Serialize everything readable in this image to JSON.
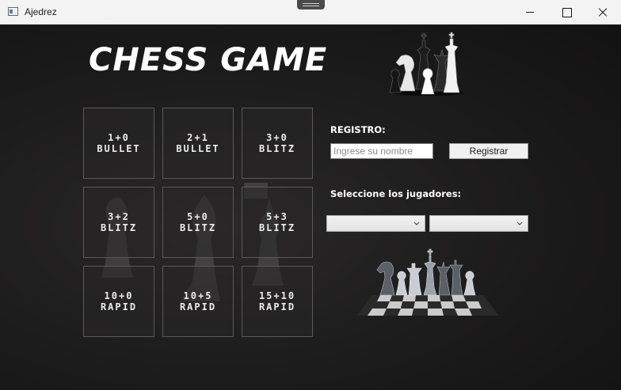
{
  "window": {
    "title": "Ajedrez",
    "icon": "app-window-icon",
    "controls": [
      "minimize-icon",
      "maximize-icon",
      "close-icon"
    ]
  },
  "main": {
    "title": "CHESS GAME",
    "tiles": [
      {
        "time": "1+0",
        "mode": "BULLET"
      },
      {
        "time": "2+1",
        "mode": "BULLET"
      },
      {
        "time": "3+0",
        "mode": "BLITZ"
      },
      {
        "time": "3+2",
        "mode": "BLITZ"
      },
      {
        "time": "5+0",
        "mode": "BLITZ"
      },
      {
        "time": "5+3",
        "mode": "BLITZ"
      },
      {
        "time": "10+0",
        "mode": "RAPID"
      },
      {
        "time": "10+5",
        "mode": "RAPID"
      },
      {
        "time": "15+10",
        "mode": "RAPID"
      }
    ]
  },
  "registro": {
    "label": "REGISTRO:",
    "placeholder": "Ingrese su nombre",
    "value": "",
    "button_label": "Registrar"
  },
  "players": {
    "label": "Seleccione los jugadores:",
    "player1_selected": "",
    "player2_selected": ""
  },
  "colors": {
    "background": "#1a1919",
    "tile_border": "#5a5858",
    "text": "#ffffff"
  }
}
